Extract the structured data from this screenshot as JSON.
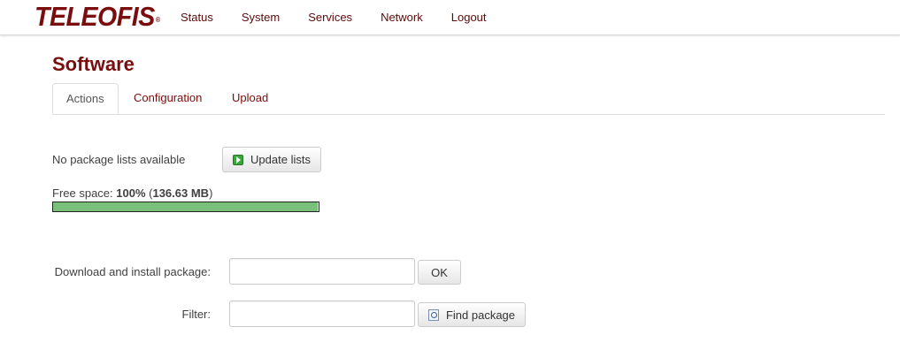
{
  "brand": "TELEOFIS",
  "brand_mark": "®",
  "nav": [
    "Status",
    "System",
    "Services",
    "Network",
    "Logout"
  ],
  "page_title": "Software",
  "tabs": [
    "Actions",
    "Configuration",
    "Upload"
  ],
  "active_tab": "Actions",
  "lists": {
    "status": "No package lists available",
    "update_label": "Update lists",
    "update_icon": "play-icon"
  },
  "free_space": {
    "prefix": "Free space: ",
    "percent": "100%",
    "open": " (",
    "size": "136.63 MB",
    "close": ")",
    "fill_fraction": 0.995
  },
  "download": {
    "label": "Download and install package:",
    "value": "",
    "ok_label": "OK"
  },
  "filter": {
    "label": "Filter:",
    "value": "",
    "find_label": "Find package",
    "find_icon": "find-icon"
  },
  "colors": {
    "brand": "#7a0d0d",
    "progress_fill": "#79c07a"
  }
}
